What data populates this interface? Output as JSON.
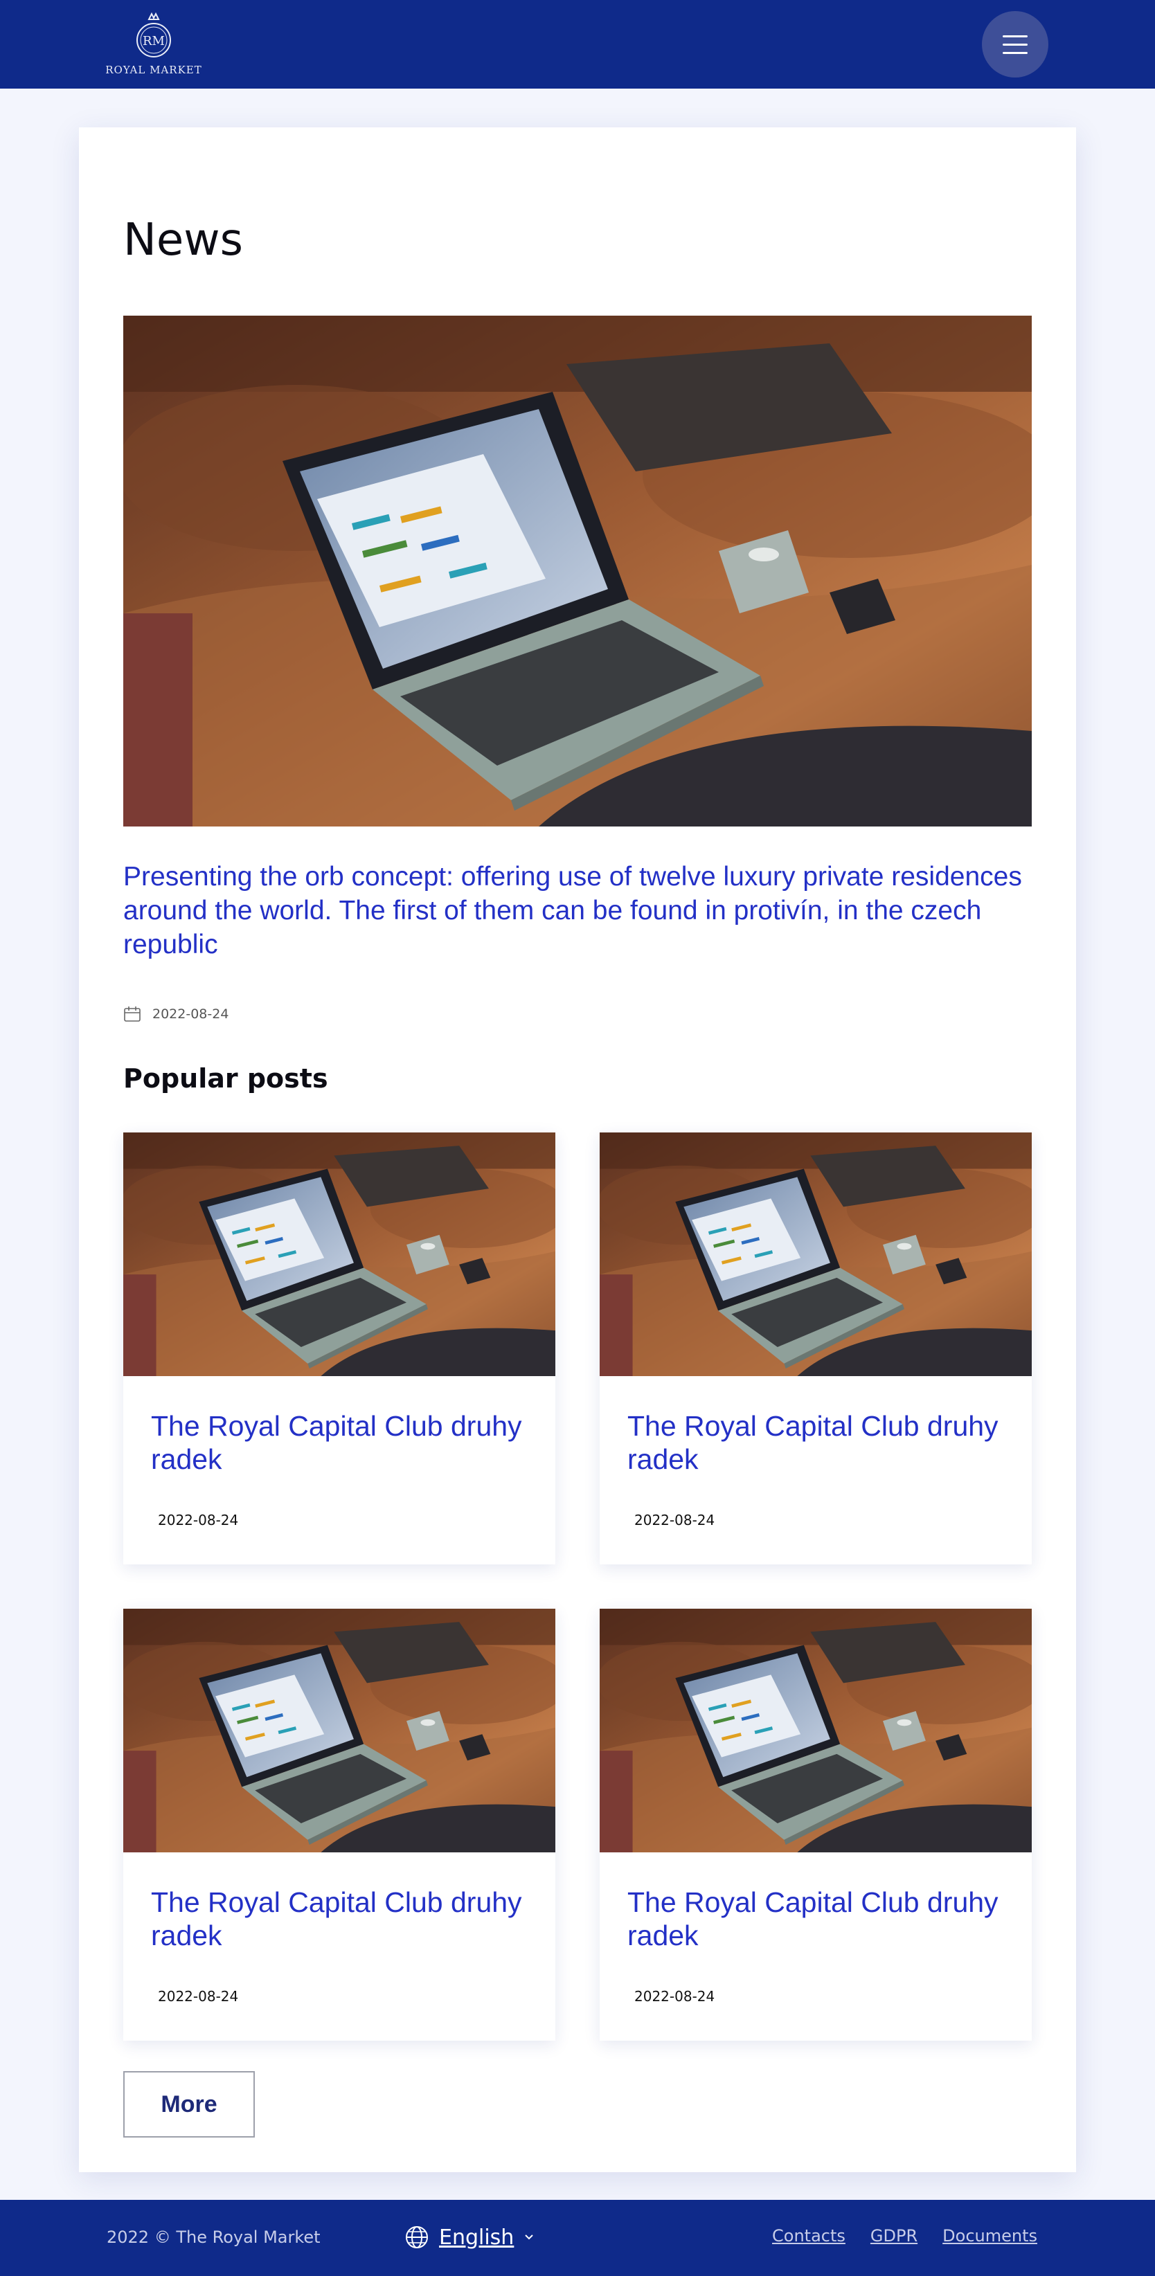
{
  "header": {
    "logo_monogram": "RM",
    "logo_text": "ROYAL MARKET",
    "menu_icon": "hamburger-icon"
  },
  "main": {
    "title": "News",
    "featured": {
      "title": "Presenting the orb concept: offering use of twelve luxury private residences around the world. The first of them can be found in protivín, in the czech republic",
      "date": "2022-08-24",
      "date_icon": "calendar-icon"
    },
    "popular_title": "Popular posts",
    "posts": [
      {
        "title": "The Royal Capital Club druhy radek",
        "date": "2022-08-24"
      },
      {
        "title": "The Royal Capital Club druhy radek",
        "date": "2022-08-24"
      },
      {
        "title": "The Royal Capital Club druhy radek",
        "date": "2022-08-24"
      },
      {
        "title": "The Royal Capital Club druhy radek",
        "date": "2022-08-24"
      }
    ],
    "more_label": "More"
  },
  "footer": {
    "copyright": "2022 © The Royal Market",
    "language": "English",
    "links": [
      "Contacts",
      "GDPR",
      "Documents"
    ]
  },
  "colors": {
    "brand_navy": "#0f2a8a",
    "link_blue": "#2330c6",
    "page_bg": "#f3f5fd"
  }
}
